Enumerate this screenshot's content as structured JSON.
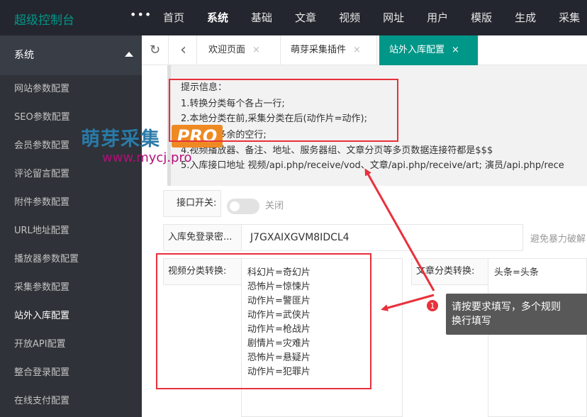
{
  "app": {
    "title": "超级控制台"
  },
  "top_nav": {
    "more": "•••",
    "items": [
      "首页",
      "系统",
      "基础",
      "文章",
      "视频",
      "网址",
      "用户",
      "模版",
      "生成",
      "采集"
    ],
    "active": "系统"
  },
  "sidebar": {
    "section": "系统",
    "items": [
      "网站参数配置",
      "SEO参数配置",
      "会员参数配置",
      "评论留言配置",
      "附件参数配置",
      "URL地址配置",
      "播放器参数配置",
      "采集参数配置",
      "站外入库配置",
      "开放API配置",
      "整合登录配置",
      "在线支付配置"
    ],
    "active": "站外入库配置"
  },
  "tabs": {
    "refresh_icon": "↻",
    "back_icon": "‹",
    "close_icon": "×",
    "items": [
      "欢迎页面",
      "萌芽采集插件",
      "站外入库配置"
    ],
    "active": "站外入库配置"
  },
  "tips": {
    "lines": [
      "提示信息：",
      "1.转换分类每个各占一行;",
      "2.本地分类在前,采集分类在后(动作片=动作);",
      "3.不要有多余的空行;",
      "4.视频播放器、备注、地址、服务器组、文章分页等多页数据连接符都是$$$",
      "5.入库接口地址 视频/api.php/receive/vod、文章/api.php/receive/art;  演员/api.php/rece"
    ]
  },
  "form": {
    "switch_label": "接口开关:",
    "switch_text": "关闭",
    "password_label": "入库免登录密...",
    "password_value": "J7GXAIXGVM8IDCL4",
    "password_hint": "避免暴力破解",
    "vod_label": "视频分类转换:",
    "vod_mappings": [
      "科幻片=奇幻片",
      "恐怖片=惊悚片",
      "动作片=警匪片",
      "动作片=武侠片",
      "动作片=枪战片",
      "剧情片=灾难片",
      "恐怖片=悬疑片",
      "动作片=犯罪片"
    ],
    "art_label": "文章分类转换:",
    "art_mappings": [
      "头条=头条"
    ]
  },
  "watermark": {
    "title": "萌芽采集",
    "pro": "PRO",
    "url": "www.mycj.pro"
  },
  "annotation": {
    "badge": "1",
    "text_line1": "请按要求填写，多个规则",
    "text_line2": "换行填写"
  },
  "colors": {
    "accent": "#009688",
    "topbar": "#23262e",
    "sidebar": "#2f3238",
    "annotation_red": "#e8313b"
  }
}
